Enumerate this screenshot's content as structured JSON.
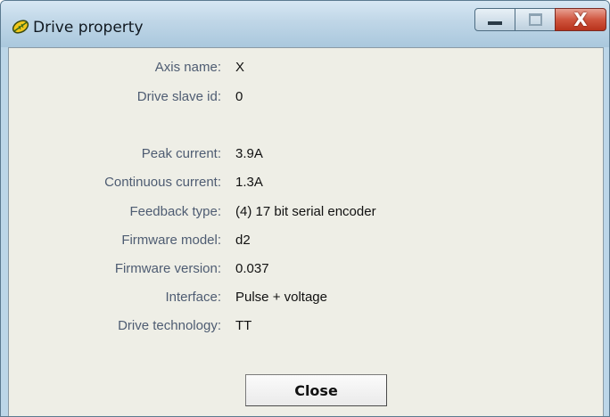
{
  "window": {
    "title": "Drive property",
    "title_icon": "leaf-app-icon",
    "controls": {
      "minimize_icon": "minimize-icon",
      "maximize_icon": "maximize-icon",
      "close_icon": "close-icon",
      "close_glyph": "X"
    }
  },
  "properties": [
    {
      "label": "Axis name:",
      "value": "X"
    },
    {
      "label": "Drive slave id:",
      "value": "0"
    },
    {
      "label": "Peak current:",
      "value": "3.9A"
    },
    {
      "label": "Continuous current:",
      "value": "1.3A"
    },
    {
      "label": "Feedback type:",
      "value": "(4) 17 bit serial encoder"
    },
    {
      "label": "Firmware model:",
      "value": "d2"
    },
    {
      "label": "Firmware version:",
      "value": "0.037"
    },
    {
      "label": "Interface:",
      "value": "Pulse + voltage"
    },
    {
      "label": "Drive technology:",
      "value": "TT"
    }
  ],
  "actions": {
    "close_label": "Close"
  },
  "colors": {
    "label_text": "#4e5c72",
    "value_text": "#111111",
    "panel_bg": "#eeeee6",
    "frame": "#bcd6e8",
    "close_button_red": "#c8432b"
  }
}
